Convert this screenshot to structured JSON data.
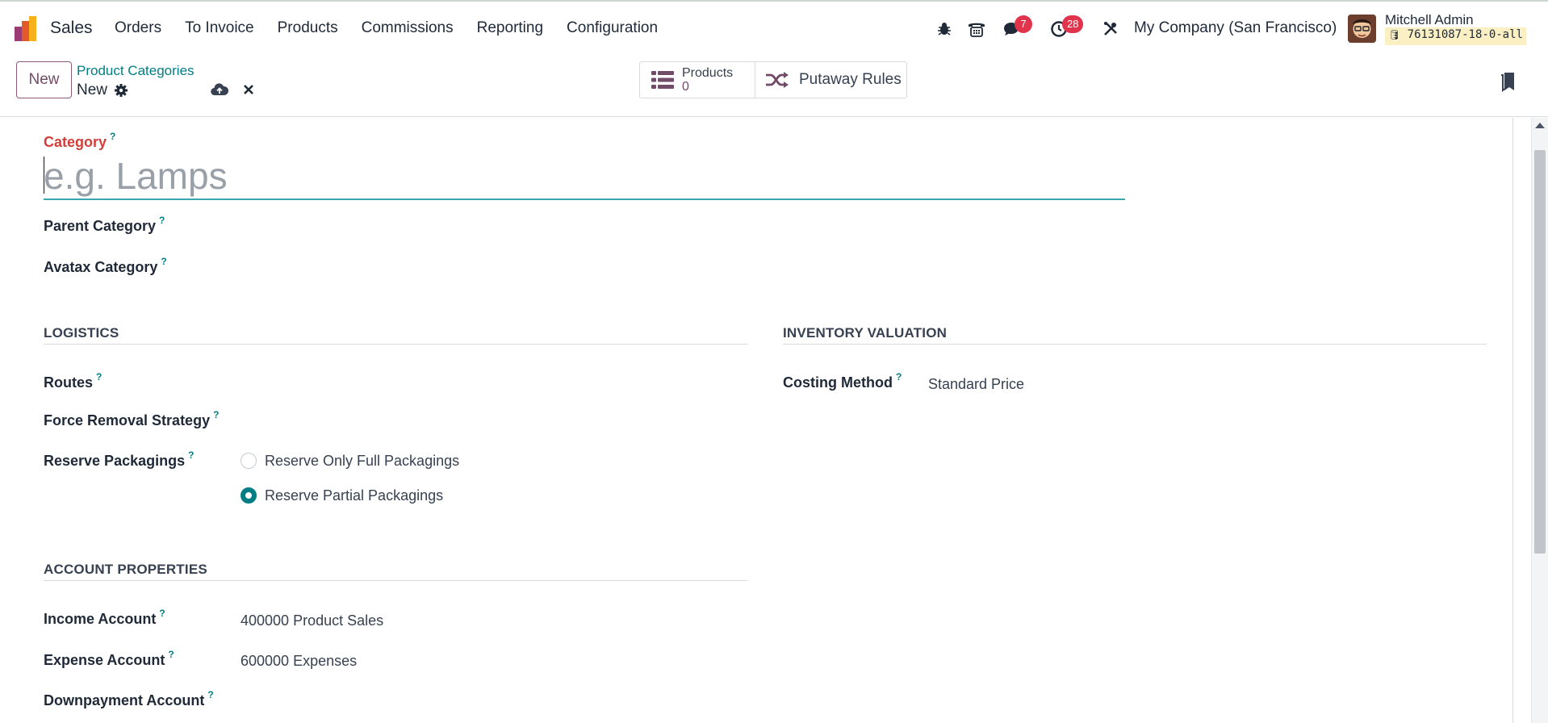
{
  "app": {
    "name": "Sales"
  },
  "menu": [
    "Orders",
    "To Invoice",
    "Products",
    "Commissions",
    "Reporting",
    "Configuration"
  ],
  "systray": {
    "messages_count": "7",
    "activities_count": "28",
    "company": "My Company (San Francisco)",
    "user_name": "Mitchell Admin",
    "database": "76131087-18-0-all"
  },
  "control": {
    "new_label": "New",
    "breadcrumb": "Product Categories",
    "record_name": "New"
  },
  "smart_buttons": {
    "products_label": "Products",
    "products_count": "0",
    "putaway_label": "Putaway Rules"
  },
  "form": {
    "category_label": "Category",
    "category_placeholder": "e.g. Lamps",
    "help_mark": "?",
    "parent_category_label": "Parent Category",
    "avatax_category_label": "Avatax Category",
    "logistics": {
      "title": "LOGISTICS",
      "routes_label": "Routes",
      "force_removal_label": "Force Removal Strategy",
      "reserve_packagings_label": "Reserve Packagings",
      "reserve_options": [
        "Reserve Only Full Packagings",
        "Reserve Partial Packagings"
      ],
      "reserve_selected": "Reserve Partial Packagings"
    },
    "inventory_valuation": {
      "title": "INVENTORY VALUATION",
      "costing_method_label": "Costing Method",
      "costing_method_value": "Standard Price"
    },
    "account_properties": {
      "title": "ACCOUNT PROPERTIES",
      "income_label": "Income Account",
      "income_value": "400000 Product Sales",
      "expense_label": "Expense Account",
      "expense_value": "600000 Expenses",
      "downpayment_label": "Downpayment Account"
    }
  },
  "colors": {
    "brand": "#714b67",
    "accent": "#017e84",
    "badge": "#e0344c",
    "required": "#d23f3a"
  }
}
